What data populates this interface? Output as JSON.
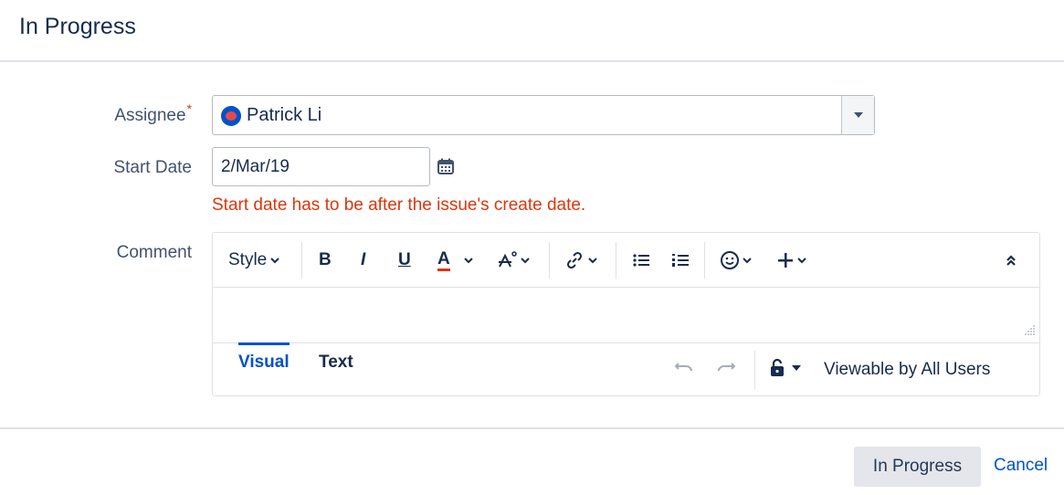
{
  "dialog": {
    "title": "In Progress"
  },
  "form": {
    "assignee": {
      "label": "Assignee",
      "required_marker": "*",
      "value": "Patrick Li"
    },
    "start_date": {
      "label": "Start Date",
      "value": "2/Mar/19",
      "error": "Start date has to be after the issue's create date."
    },
    "comment": {
      "label": "Comment",
      "toolbar": {
        "style_label": "Style",
        "bold": "B",
        "italic": "I",
        "underline": "U",
        "text_color": "A",
        "text_color_accent": "#de350b"
      },
      "tabs": [
        {
          "label": "Visual",
          "active": true
        },
        {
          "label": "Text",
          "active": false
        }
      ],
      "visibility": "Viewable by All Users"
    }
  },
  "footer": {
    "submit_label": "In Progress",
    "cancel_label": "Cancel"
  }
}
